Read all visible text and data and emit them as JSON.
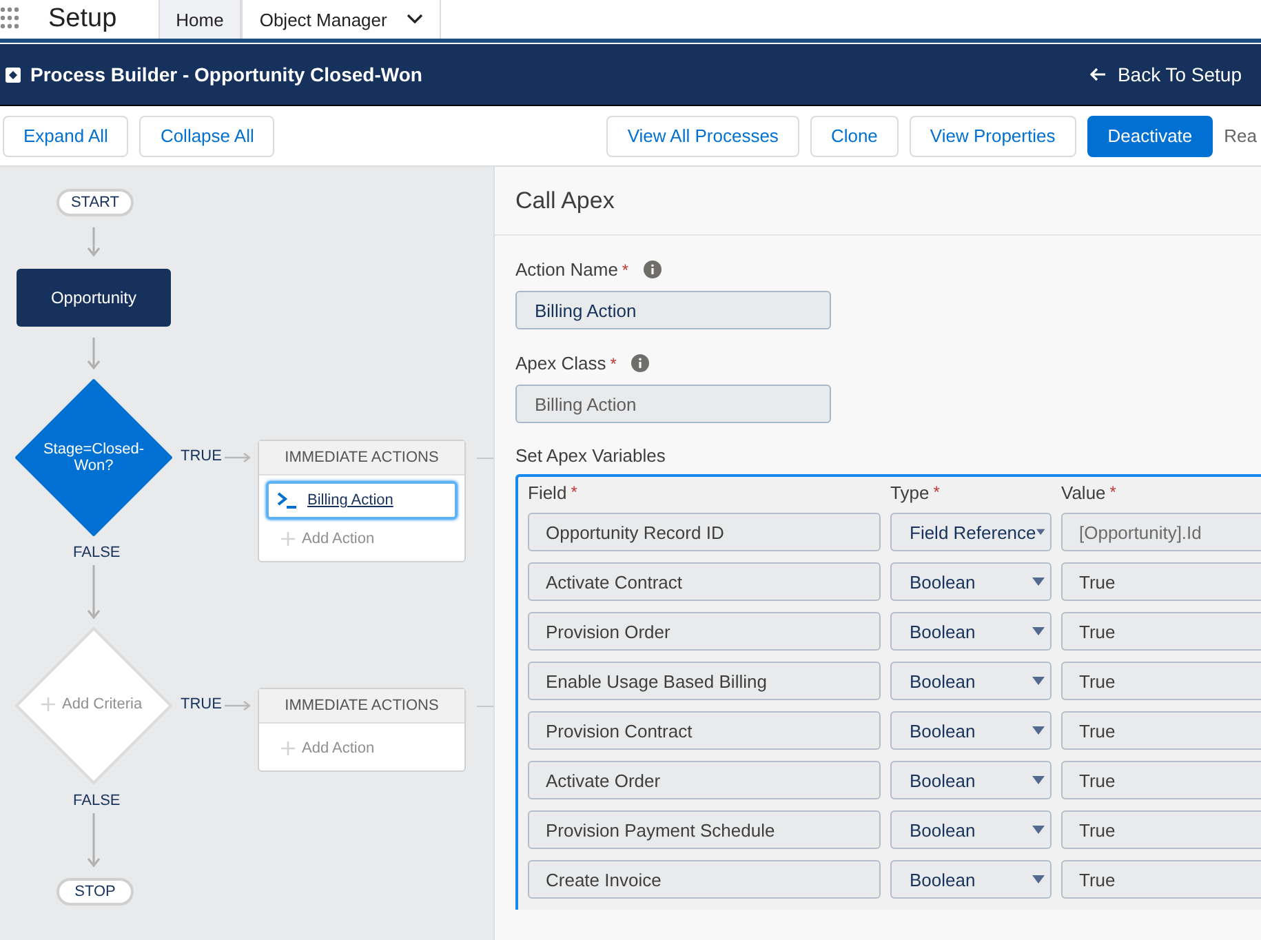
{
  "top_nav": {
    "app_name": "Setup",
    "tabs": [
      {
        "label": "Home",
        "selected": true,
        "has_menu": false
      },
      {
        "label": "Object Manager",
        "selected": false,
        "has_menu": true
      }
    ]
  },
  "header": {
    "title": "Process Builder - Opportunity Closed-Won",
    "back_link": "Back To Setup"
  },
  "toolbar": {
    "left_buttons": [
      {
        "label": "Expand All"
      },
      {
        "label": "Collapse All"
      }
    ],
    "right_buttons": [
      {
        "label": "View All Processes",
        "kind": "neutral"
      },
      {
        "label": "Clone",
        "kind": "neutral"
      },
      {
        "label": "View Properties",
        "kind": "neutral"
      },
      {
        "label": "Deactivate",
        "kind": "brand"
      }
    ],
    "status_text": "Rea"
  },
  "canvas": {
    "start": "START",
    "object_node": "Opportunity",
    "criteria": [
      {
        "kind": "defined",
        "label": "Stage=Closed-Won?",
        "true_label": "TRUE",
        "false_label": "FALSE",
        "actions_header": "IMMEDIATE ACTIONS",
        "actions": [
          {
            "label": "Billing Action",
            "selected": true
          }
        ],
        "add_action": "Add Action"
      },
      {
        "kind": "empty",
        "label": "Add Criteria",
        "true_label": "TRUE",
        "false_label": "FALSE",
        "actions_header": "IMMEDIATE ACTIONS",
        "add_action": "Add Action"
      }
    ],
    "stop": "STOP"
  },
  "panel": {
    "title": "Call Apex",
    "fields": [
      {
        "label": "Action Name",
        "required_mark": "*",
        "value": "Billing Action",
        "disabled": false
      },
      {
        "label": "Apex Class",
        "required_mark": "*",
        "value": "Billing Action",
        "disabled": true
      }
    ],
    "variables_label": "Set Apex Variables",
    "columns": [
      {
        "label": "Field",
        "required_mark": "*"
      },
      {
        "label": "Type",
        "required_mark": "*"
      },
      {
        "label": "Value",
        "required_mark": "*"
      }
    ],
    "rows": [
      {
        "field": "Opportunity Record ID",
        "type": "Field Reference",
        "placeholder": "[Opportunity].Id"
      },
      {
        "field": "Activate Contract",
        "type": "Boolean",
        "value": "True"
      },
      {
        "field": "Provision Order",
        "type": "Boolean",
        "value": "True"
      },
      {
        "field": "Enable Usage Based Billing",
        "type": "Boolean",
        "value": "True"
      },
      {
        "field": "Provision Contract",
        "type": "Boolean",
        "value": "True"
      },
      {
        "field": "Activate Order",
        "type": "Boolean",
        "value": "True"
      },
      {
        "field": "Provision Payment Schedule",
        "type": "Boolean",
        "value": "True"
      },
      {
        "field": "Create Invoice",
        "type": "Boolean",
        "value": "True"
      }
    ]
  }
}
